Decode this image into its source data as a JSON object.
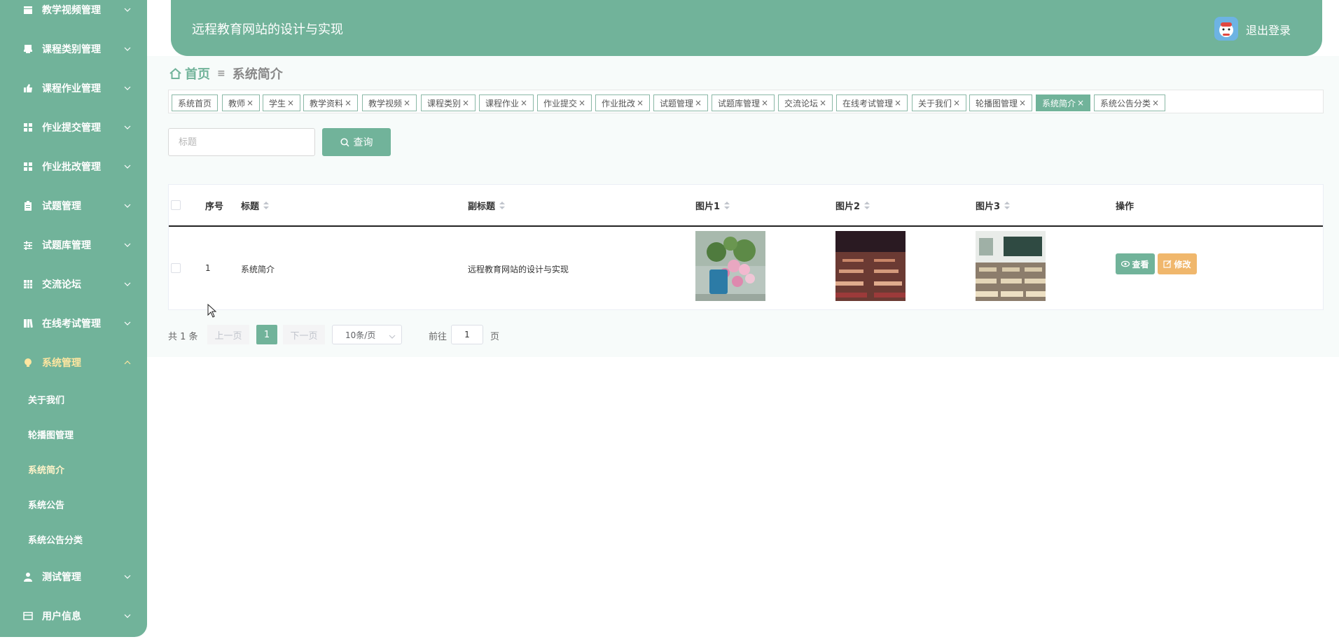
{
  "sidebar": {
    "items": [
      {
        "label": "教学视频管理",
        "icon": "calendar-icon"
      },
      {
        "label": "课程类别管理",
        "icon": "printer-icon"
      },
      {
        "label": "课程作业管理",
        "icon": "thumb-icon"
      },
      {
        "label": "作业提交管理",
        "icon": "grid-icon"
      },
      {
        "label": "作业批改管理",
        "icon": "grid-icon"
      },
      {
        "label": "试题管理",
        "icon": "clipboard-icon"
      },
      {
        "label": "试题库管理",
        "icon": "sliders-icon"
      },
      {
        "label": "交流论坛",
        "icon": "table-icon"
      },
      {
        "label": "在线考试管理",
        "icon": "book-icon"
      },
      {
        "label": "系统管理",
        "icon": "bulb-icon"
      },
      {
        "label": "测试管理",
        "icon": "user-icon"
      },
      {
        "label": "用户信息",
        "icon": "card-icon"
      }
    ],
    "submenu": [
      "关于我们",
      "轮播图管理",
      "系统简介",
      "系统公告",
      "系统公告分类"
    ]
  },
  "header": {
    "title": "远程教育网站的设计与实现",
    "logout": "退出登录"
  },
  "breadcrumb": {
    "home": "首页",
    "current": "系统简介"
  },
  "tags": [
    "系统首页",
    "教师",
    "学生",
    "教学资料",
    "教学视频",
    "课程类别",
    "课程作业",
    "作业提交",
    "作业批改",
    "试题管理",
    "试题库管理",
    "交流论坛",
    "在线考试管理",
    "关于我们",
    "轮播图管理",
    "系统简介",
    "系统公告分类"
  ],
  "search": {
    "placeholder": "标题",
    "button": "查询"
  },
  "table": {
    "headers": [
      "序号",
      "标题",
      "副标题",
      "图片1",
      "图片2",
      "图片3",
      "操作"
    ],
    "rows": [
      {
        "index": "1",
        "title": "系统简介",
        "subtitle": "远程教育网站的设计与实现"
      }
    ],
    "view": "查看",
    "edit": "修改"
  },
  "pagination": {
    "total": "共 1 条",
    "prev": "上一页",
    "current": "1",
    "next": "下一页",
    "page_size": "10条/页",
    "goto_label": "前往",
    "goto_value": "1",
    "goto_suffix": "页"
  },
  "colors": {
    "primary": "#71b39a",
    "edit": "#f0b76c"
  }
}
